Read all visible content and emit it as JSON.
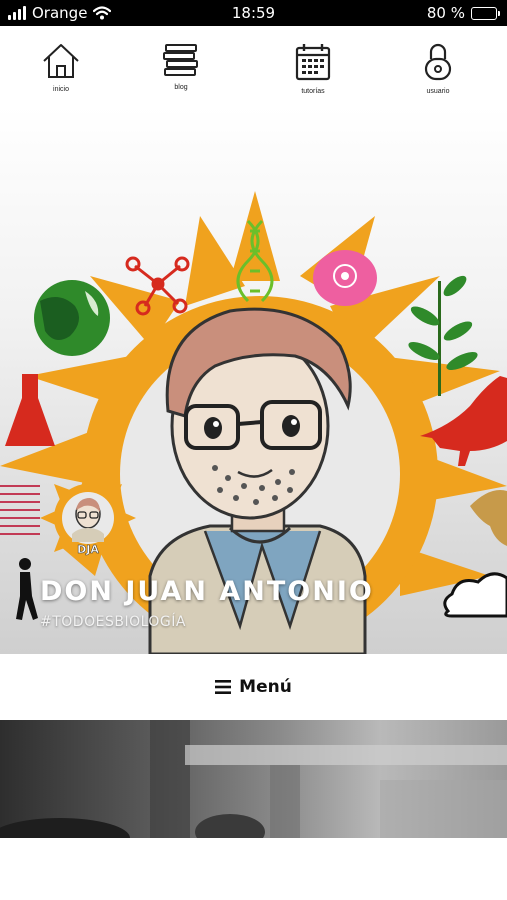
{
  "status_bar": {
    "carrier": "Orange",
    "time": "18:59",
    "battery_percent": "80 %",
    "battery_level": 0.8
  },
  "nav": {
    "items": [
      {
        "label": "inicio",
        "icon": "home-icon"
      },
      {
        "label": "blog",
        "icon": "books-icon"
      },
      {
        "label": "tutorías",
        "icon": "calendar-icon"
      },
      {
        "label": "usuario",
        "icon": "lock-icon"
      }
    ]
  },
  "hero": {
    "title": "DON JUAN ANTONIO",
    "tagline": "#TODOESBIOLOGÍA",
    "logo_text": "DJA"
  },
  "menu": {
    "label": "Menú",
    "icon": "hamburger-icon"
  },
  "colors": {
    "sun": "#f0a21e",
    "accent_red": "#d62a1e",
    "leaf_green": "#2f8a2a",
    "pink": "#ee5fa0"
  }
}
